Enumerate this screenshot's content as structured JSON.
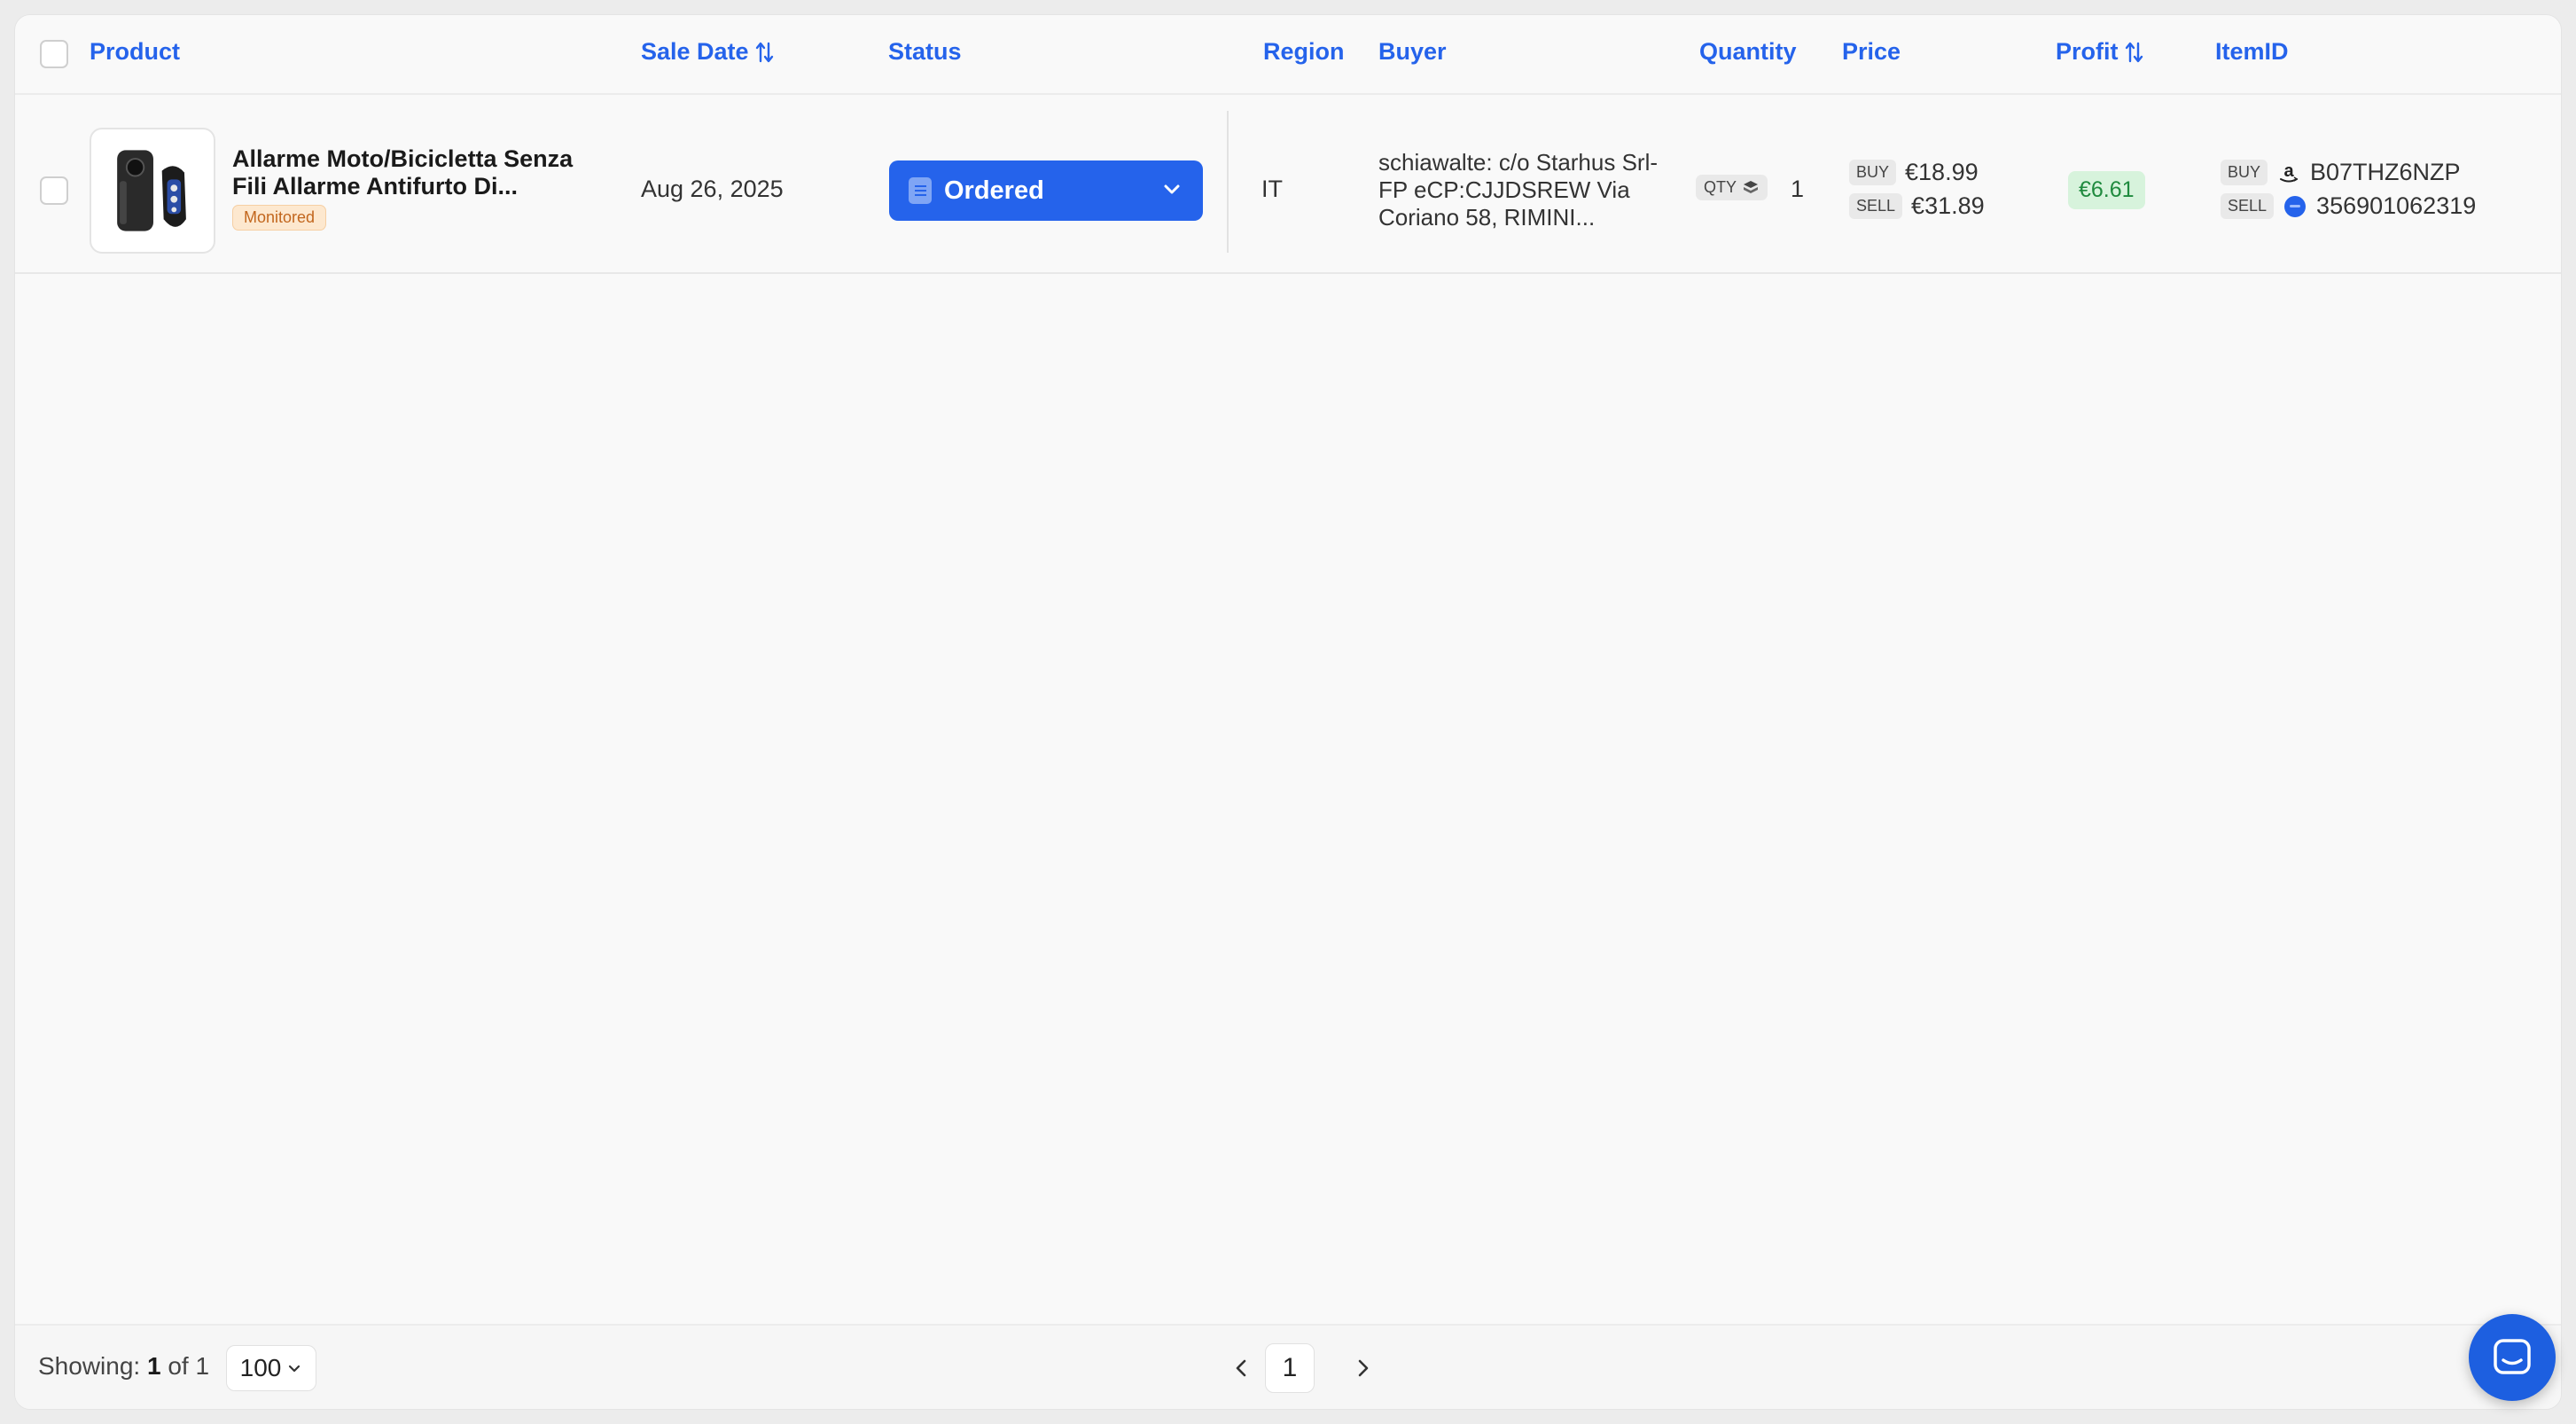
{
  "colors": {
    "accent": "#2563eb",
    "profit_bg": "#d7f3dc",
    "profit_text": "#1f8a3e",
    "monitored_bg": "#fde8cf",
    "monitored_text": "#c2661d"
  },
  "table": {
    "columns": {
      "product": "Product",
      "sale_date": "Sale Date",
      "status": "Status",
      "region": "Region",
      "buyer": "Buyer",
      "quantity": "Quantity",
      "price": "Price",
      "profit": "Profit",
      "item_id": "ItemID"
    },
    "rows": [
      {
        "product_title": "Allarme Moto/Bicicletta Senza Fili Allarme Antifurto Di...",
        "product_badge": "Monitored",
        "sale_date": "Aug 26, 2025",
        "status": "Ordered",
        "region": "IT",
        "buyer": "schiawalte: c/o Starhus Srl-FP eCP:CJJDSREW Via Coriano 58, RIMINI...",
        "qty_label": "QTY",
        "quantity": "1",
        "buy_label": "BUY",
        "buy_price": "€18.99",
        "sell_label": "SELL",
        "sell_price": "€31.89",
        "profit": "€6.61",
        "buy_item_id": "B07THZ6NZP",
        "sell_item_id": "356901062319"
      }
    ]
  },
  "footer": {
    "showing_label": "Showing:",
    "showing_count": "1",
    "showing_of": "of 1",
    "per_page": "100",
    "current_page": "1"
  },
  "icons": {
    "sort": "sort-arrows-icon",
    "status": "document-icon",
    "dropdown": "chevron-down-icon",
    "qty": "box-stack-icon",
    "buy_source": "amazon-icon",
    "sell_source": "ebay-icon",
    "prev": "chevron-left-icon",
    "next": "chevron-right-icon",
    "chat": "chat-icon"
  }
}
